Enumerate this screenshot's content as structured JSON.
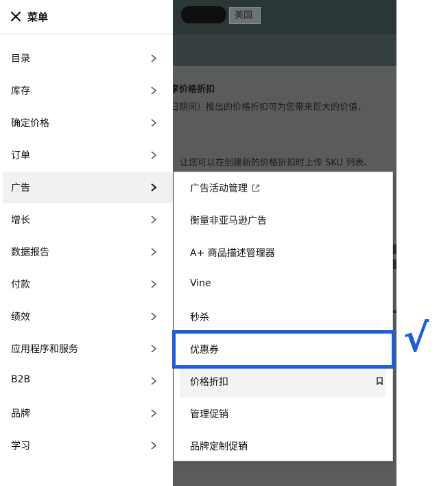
{
  "background": {
    "region_label": "美国",
    "heading": "享价格折扣",
    "text_line1": "日期间）推出的价格折扣可为您带来巨大的价值，",
    "text_line2": "让您可以在创建新的价格折扣时上传 SKU 列表、"
  },
  "menu": {
    "title": "菜单",
    "items": [
      {
        "label": "目录"
      },
      {
        "label": "库存"
      },
      {
        "label": "确定价格"
      },
      {
        "label": "订单"
      },
      {
        "label": "广告"
      },
      {
        "label": "增长"
      },
      {
        "label": "数据报告"
      },
      {
        "label": "付款"
      },
      {
        "label": "绩效"
      },
      {
        "label": "应用程序和服务"
      },
      {
        "label": "B2B"
      },
      {
        "label": "品牌"
      },
      {
        "label": "学习"
      }
    ],
    "active_item": "广告"
  },
  "submenu": {
    "items": [
      {
        "label": "广告活动管理",
        "icon": "external-link-icon"
      },
      {
        "label": "衡量非亚马逊广告"
      },
      {
        "label": "A+ 商品描述管理器"
      },
      {
        "label": "Vine"
      },
      {
        "label": "秒杀"
      },
      {
        "label": "优惠券"
      },
      {
        "label": "价格折扣",
        "icon": "bookmark-icon"
      },
      {
        "label": "管理促销"
      },
      {
        "label": "品牌定制促销"
      }
    ],
    "highlighted_item": "优惠券",
    "hovered_item": "价格折扣"
  },
  "annotation": {
    "mark": "√",
    "color": "#1f5fd6"
  }
}
